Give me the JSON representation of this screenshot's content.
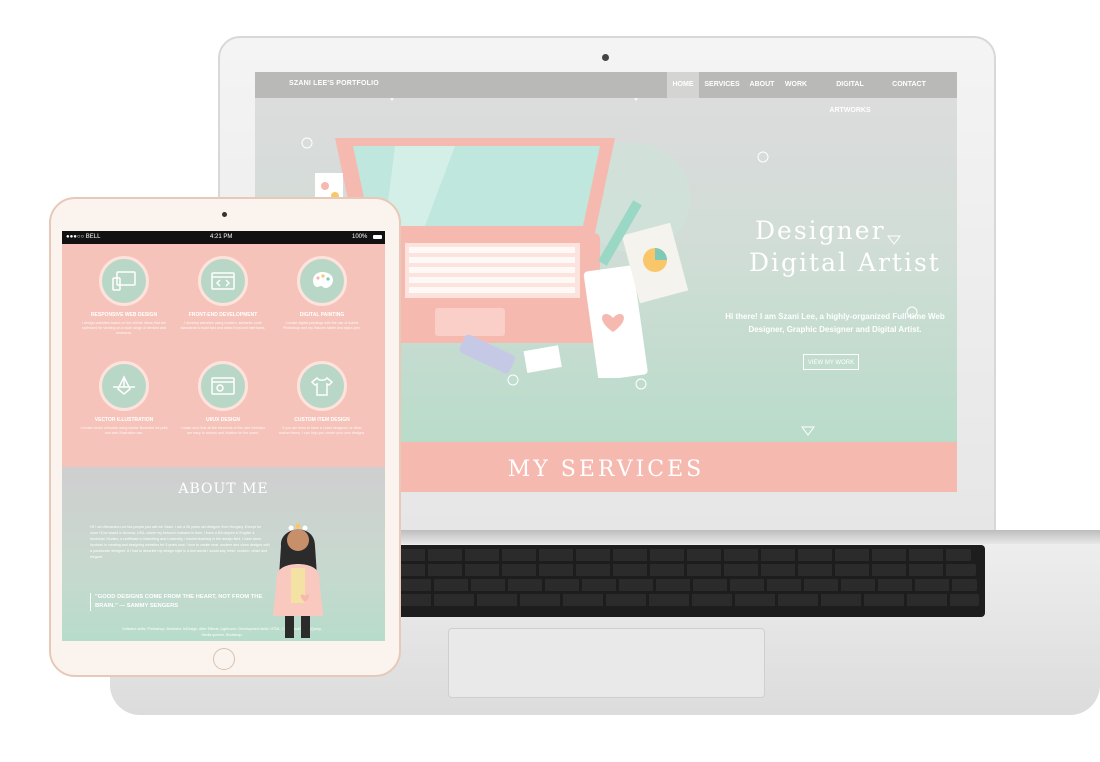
{
  "laptop_site": {
    "brand": "SZANI LEE'S PORTFOLIO",
    "nav": [
      {
        "label": "HOME",
        "active": true
      },
      {
        "label": "SERVICES",
        "active": false
      },
      {
        "label": "ABOUT",
        "active": false
      },
      {
        "label": "WORK",
        "active": false
      },
      {
        "label": "DIGITAL ARTWORKS",
        "active": false
      },
      {
        "label": "CONTACT",
        "active": false
      }
    ],
    "hero": {
      "title_line1": "Designer",
      "title_line2": "Digital Artist",
      "intro": "Hi there! I am Szani Lee, a highly-organized Full-time Web Designer, Graphic Designer and Digital Artist.",
      "button": "VIEW MY WORK"
    },
    "services_heading": "MY SERVICES"
  },
  "tablet_site": {
    "status": {
      "carrier": "●●●○○ BELL",
      "time": "4:21 PM",
      "battery": "100%"
    },
    "services": [
      {
        "name": "RESPONSIVE WEB DESIGN",
        "icon": "devices-icon",
        "desc": "I design websites based on the clients' ideas that are optimized for viewing on a wide range of devices and browsers."
      },
      {
        "name": "FRONT-END DEVELOPMENT",
        "icon": "code-window-icon",
        "desc": "I develop websites using modern, semantic code standards to build fast and clean front-end interfaces."
      },
      {
        "name": "DIGITAL PAINTING",
        "icon": "palette-icon",
        "desc": "I create digital paintings with the use of Adobe Photoshop and my Wacom tablet and stylus pen."
      },
      {
        "name": "VECTOR ILLUSTRATION",
        "icon": "pen-tool-icon",
        "desc": "I create vector artworks using Adobe Illustrator for print and web illustration use."
      },
      {
        "name": "UI/UX DESIGN",
        "icon": "ui-window-icon",
        "desc": "I make sure that all the elements of the user interface are easy to access and intuitive for the users."
      },
      {
        "name": "CUSTOM ITEM DESIGN",
        "icon": "tshirt-icon",
        "desc": "If you are keen to have a t-shirt designed, or other custom items, I can help you create your own designs."
      }
    ],
    "about": {
      "title": "ABOUT ME",
      "body": "Hi! I am Alexandra Lee but people just call me Szani. I am a 26 years old designer from Hungary. Except for more I'll be based in Arizona, USA, where my beloved husband is from. I have a BA degree in English & American Studies, a certificate in Marketing and University / tutorial teaching in the design field. I have been involved in creating and designing websites for 5 years now. I love to create neat, modern and clean designs with a passionate designer. If I had to describe my design style in a few words I would say: fresh, modern, clean and elegant.",
      "quote": "\"GOOD DESIGNS COME FROM THE HEART, NOT FROM THE BRAIN.\" — SAMMY SENGERS",
      "skills": "Software skills: Photoshop, Illustrator, InDesign, After Effects, Lightroom. Development skills: HTML, CSS, JavaScript, jQuery, Media queries, Bootstrap."
    }
  }
}
